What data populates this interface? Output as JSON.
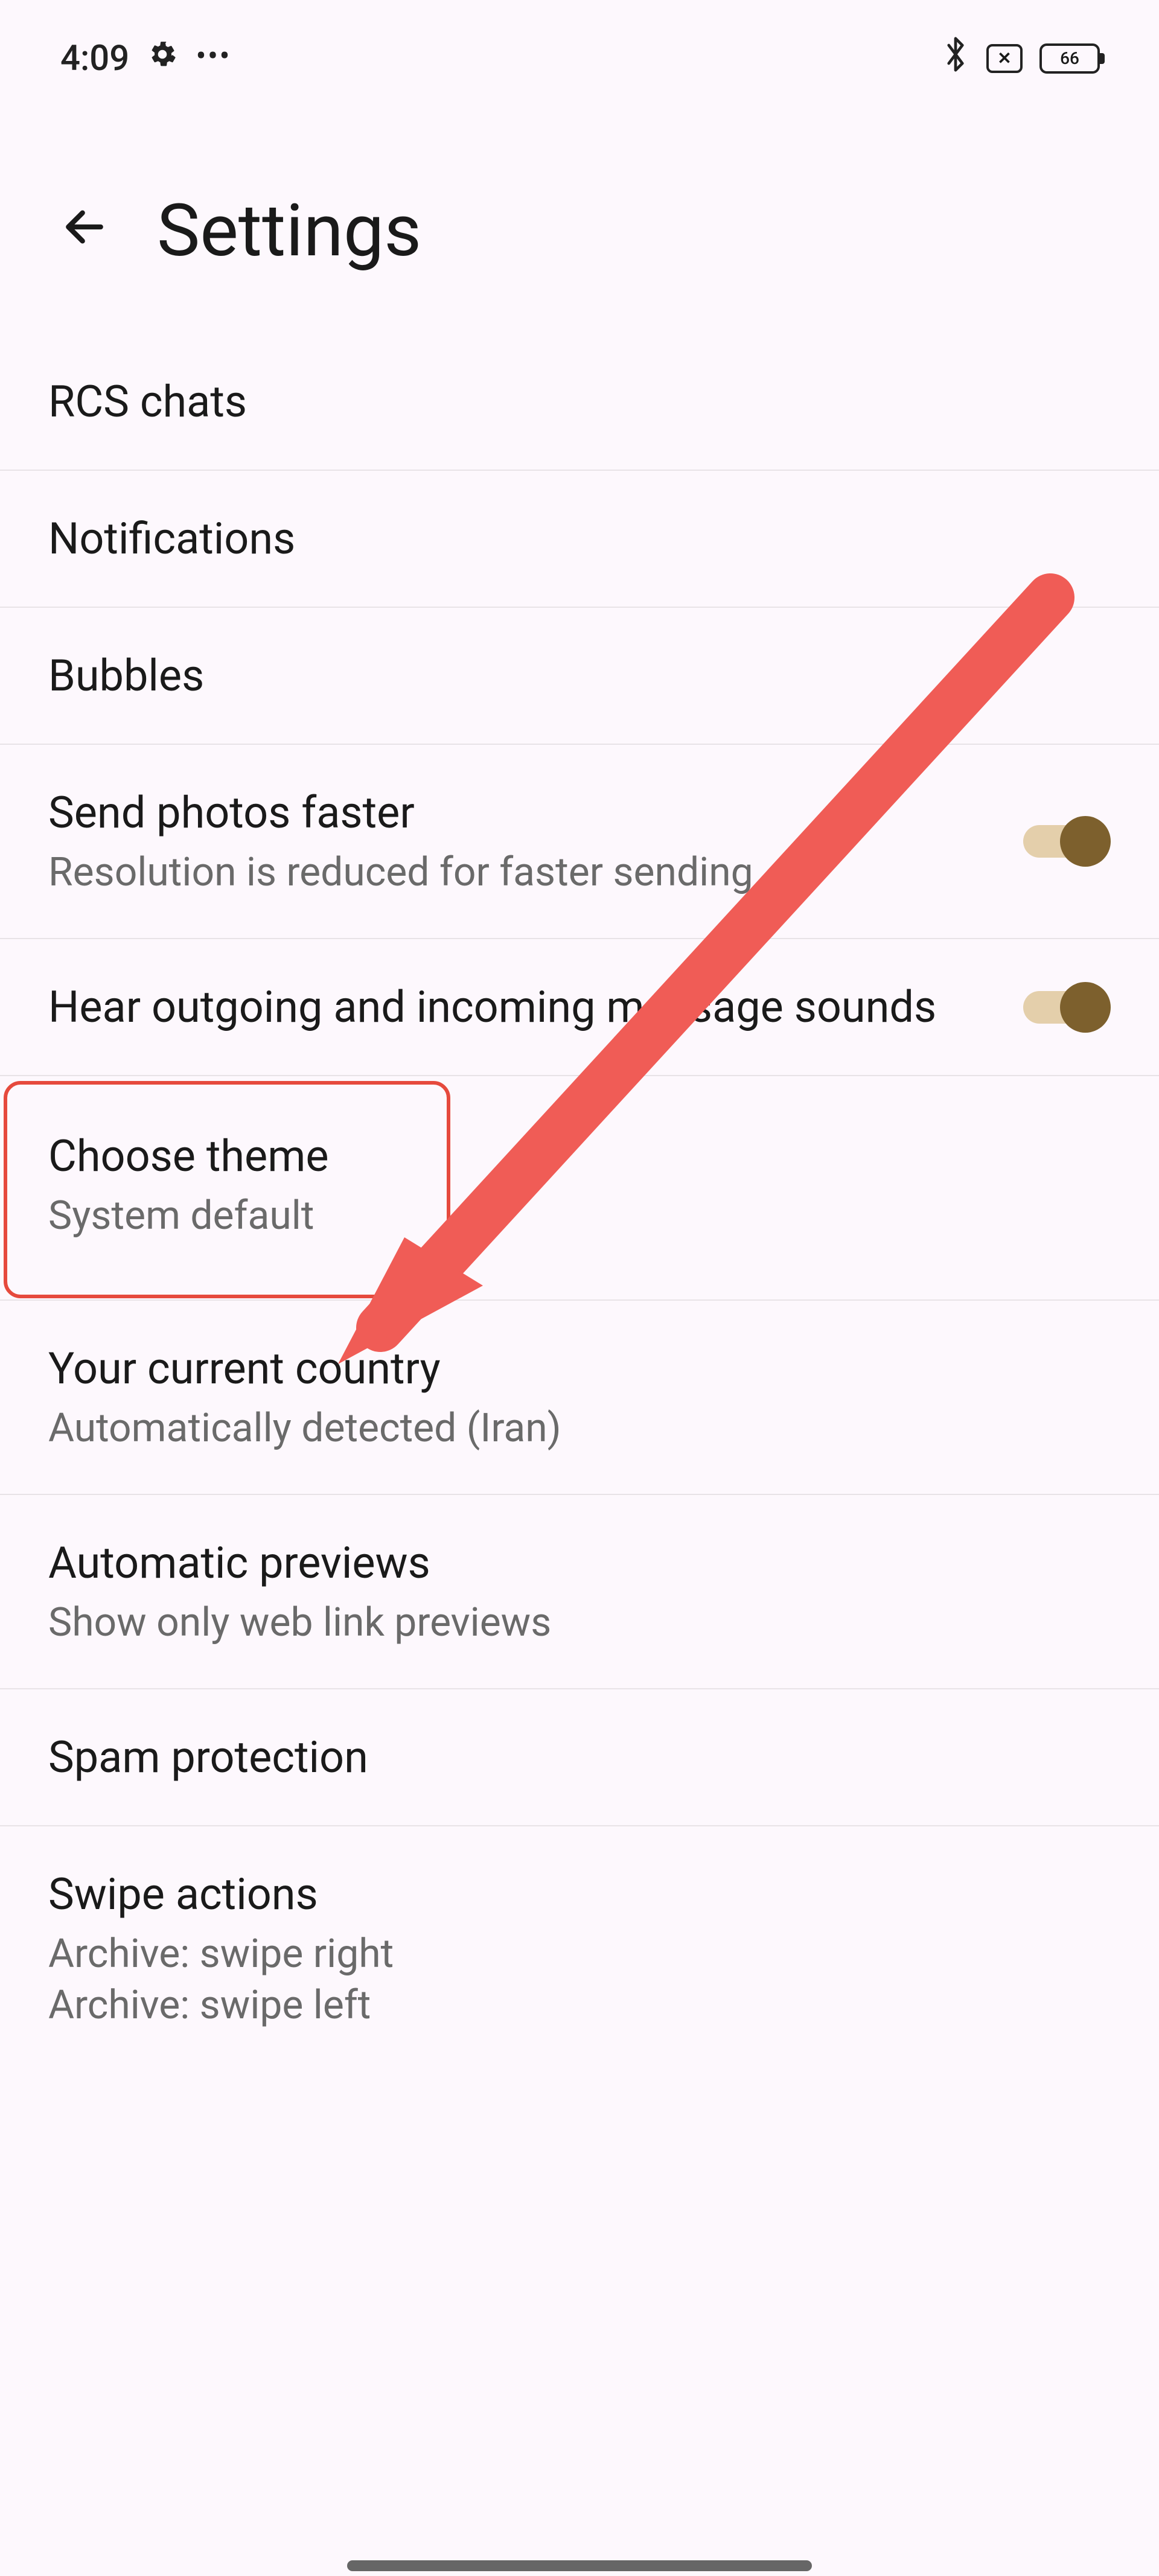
{
  "status": {
    "time": "4:09",
    "battery": "66"
  },
  "header": {
    "title": "Settings"
  },
  "settings": {
    "rcs": {
      "title": "RCS chats"
    },
    "notifications": {
      "title": "Notifications"
    },
    "bubbles": {
      "title": "Bubbles"
    },
    "send_photos": {
      "title": "Send photos faster",
      "sub": "Resolution is reduced for faster sending",
      "enabled": true
    },
    "sounds": {
      "title": "Hear outgoing and incoming message sounds",
      "enabled": true
    },
    "theme": {
      "title": "Choose theme",
      "sub": "System default"
    },
    "country": {
      "title": "Your current country",
      "sub": "Automatically detected (Iran)"
    },
    "previews": {
      "title": "Automatic previews",
      "sub": "Show only web link previews"
    },
    "spam": {
      "title": "Spam protection"
    },
    "swipe": {
      "title": "Swipe actions",
      "sub1": "Archive: swipe right",
      "sub2": "Archive: swipe left"
    }
  }
}
